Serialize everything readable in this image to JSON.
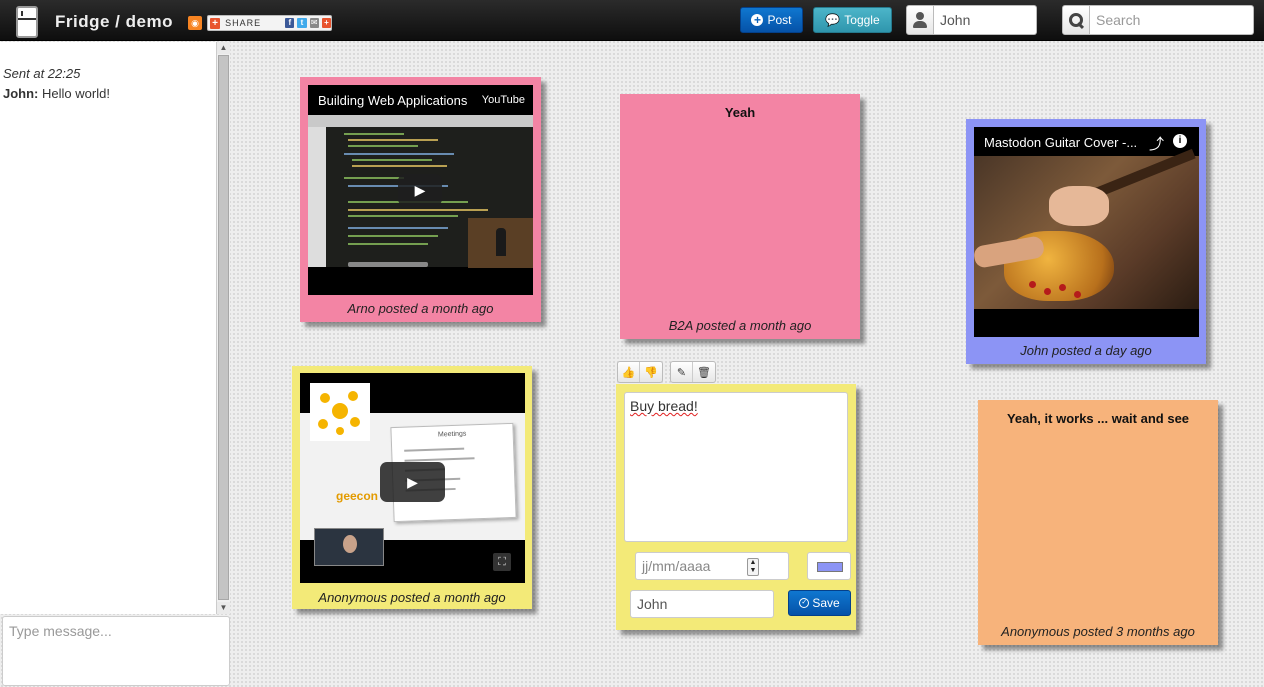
{
  "header": {
    "brand": "Fridge / demo",
    "share_label": "SHARE",
    "post_label": "Post",
    "toggle_label": "Toggle",
    "user_value": "John",
    "search_placeholder": "Search"
  },
  "chat": {
    "sent_time": "Sent at 22:25",
    "messages": [
      {
        "author": "John:",
        "text": "Hello world!"
      }
    ],
    "input_placeholder": "Type message..."
  },
  "notes": [
    {
      "type": "video",
      "video_title": "Building Web Applications",
      "platform": "YouTube",
      "caption": "Arno posted a month ago",
      "color": "#f384a4"
    },
    {
      "type": "text",
      "title": "Yeah",
      "caption": "B2A posted a month ago",
      "color": "#f384a4"
    },
    {
      "type": "video",
      "video_title": "Mastodon Guitar Cover -...",
      "caption": "John posted a day ago",
      "color": "#8c94f5"
    },
    {
      "type": "video",
      "geecon_logo": "geecon",
      "slide_title": "Meetings",
      "caption": "Anonymous posted a month ago",
      "color": "#f3ea78"
    },
    {
      "type": "edit",
      "text": "Buy bread!",
      "date_placeholder": "jj/mm/aaaa",
      "author": "John",
      "save_label": "Save",
      "swatch_color": "#8c94f5",
      "color": "#f3ea78"
    },
    {
      "type": "text",
      "title": "Yeah, it works ... wait and see",
      "caption": "Anonymous posted 3 months ago",
      "color": "#f7b37b"
    }
  ]
}
